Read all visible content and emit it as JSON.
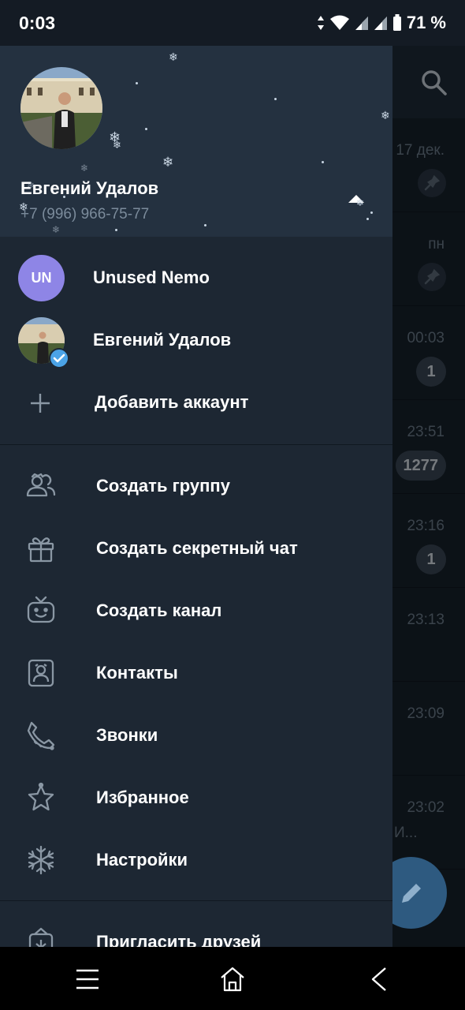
{
  "status_bar": {
    "time": "0:03",
    "battery": "71 %",
    "icons": [
      "data-arrows-icon",
      "wifi-icon",
      "signal-icon",
      "signal-icon",
      "battery-icon"
    ]
  },
  "chat_list": {
    "rows": [
      {
        "time": "17 дек.",
        "indicator": "pin"
      },
      {
        "time": "пн",
        "indicator": "pin"
      },
      {
        "time": "00:03",
        "badge": "1"
      },
      {
        "time": "23:51",
        "badge": "1277"
      },
      {
        "time": "23:16",
        "badge": "1"
      },
      {
        "time": "23:13"
      },
      {
        "time": "23:09"
      },
      {
        "time": "23:02",
        "preview": "И..."
      }
    ]
  },
  "drawer": {
    "profile": {
      "name": "Евгений Удалов",
      "phone": "+7 (996) 966-75-77"
    },
    "accounts": [
      {
        "initials": "UN",
        "name": "Unused Nemo"
      },
      {
        "name": "Евгений Удалов"
      }
    ],
    "add_account": "Добавить аккаунт",
    "menu": [
      {
        "label": "Создать группу",
        "icon": "group-icon"
      },
      {
        "label": "Создать секретный чат",
        "icon": "gift-lock-icon"
      },
      {
        "label": "Создать канал",
        "icon": "tv-channel-icon"
      },
      {
        "label": "Контакты",
        "icon": "contacts-icon"
      },
      {
        "label": "Звонки",
        "icon": "phone-icon"
      },
      {
        "label": "Избранное",
        "icon": "star-icon"
      },
      {
        "label": "Настройки",
        "icon": "snowflake-settings-icon"
      }
    ],
    "invite": {
      "label": "Пригласить друзей",
      "icon": "invite-icon"
    }
  },
  "colors": {
    "drawer_bg": "#1d2733",
    "header_bg": "#243140",
    "avatar_un": "#8e85e6",
    "verified": "#4ba3e7",
    "fab": "#2e5a80"
  }
}
